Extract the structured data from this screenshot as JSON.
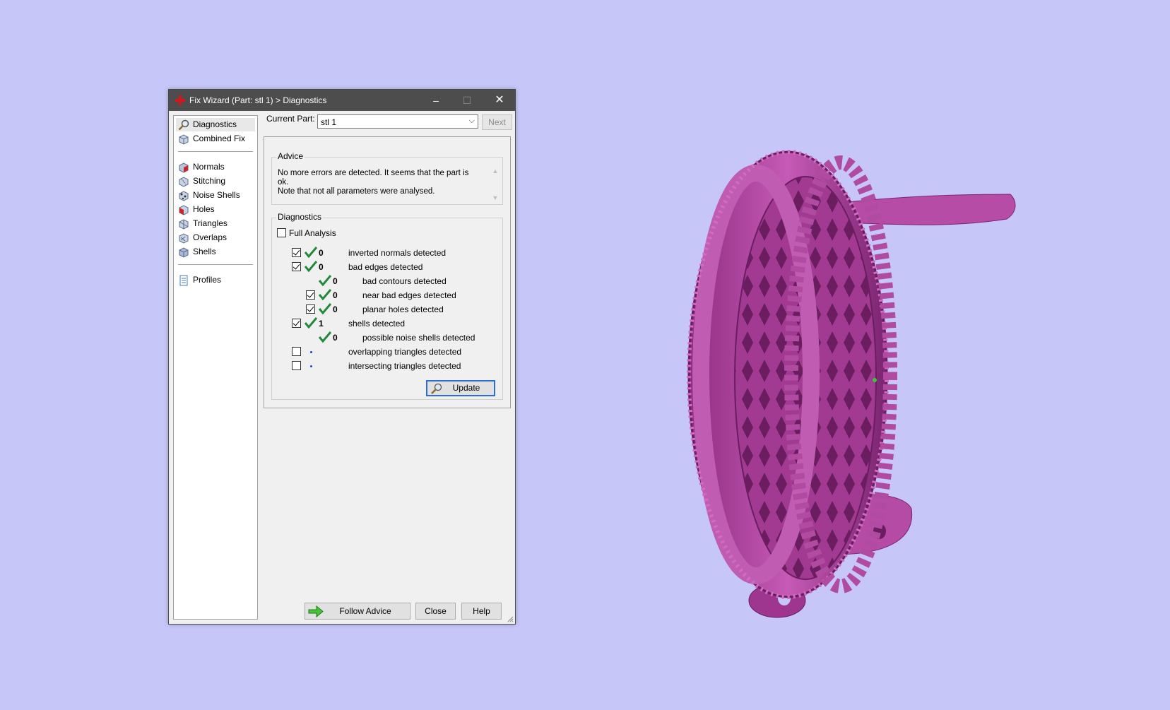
{
  "window": {
    "title": "Fix Wizard (Part: stl 1) > Diagnostics",
    "min_glyph": "–",
    "max_glyph": "☐",
    "close_glyph": "✕"
  },
  "sidebar": {
    "items": [
      {
        "label": "Diagnostics",
        "icon": "magnifier-icon"
      },
      {
        "label": "Combined Fix",
        "icon": "cube-icon"
      },
      {
        "label": "Normals",
        "icon": "cube-red-icon"
      },
      {
        "label": "Stitching",
        "icon": "cube-stitch-icon"
      },
      {
        "label": "Noise Shells",
        "icon": "noise-shells-icon"
      },
      {
        "label": "Holes",
        "icon": "cube-holes-icon"
      },
      {
        "label": "Triangles",
        "icon": "triangles-icon"
      },
      {
        "label": "Overlaps",
        "icon": "overlaps-icon"
      },
      {
        "label": "Shells",
        "icon": "shells-icon"
      },
      {
        "label": "Profiles",
        "icon": "document-icon"
      }
    ]
  },
  "header": {
    "current_part_label": "Current Part:",
    "current_part_value": "stl 1",
    "dropdown_arrow": "⌵",
    "next_label": "Next"
  },
  "advice": {
    "title": "Advice",
    "text": "No more errors are detected. It seems that the part is ok.\nNote that not all parameters were analysed.",
    "scroll_up": "▲",
    "scroll_down": "▼"
  },
  "diagnostics": {
    "title": "Diagnostics",
    "full_analysis_label": "Full Analysis",
    "rows": [
      {
        "checked": true,
        "value": "0",
        "label": "inverted normals detected"
      },
      {
        "checked": true,
        "value": "0",
        "label": "bad edges detected"
      },
      {
        "checked": null,
        "value": "0",
        "label": "bad contours detected"
      },
      {
        "checked": true,
        "value": "0",
        "label": "near bad edges detected"
      },
      {
        "checked": true,
        "value": "0",
        "label": "planar holes detected"
      },
      {
        "checked": true,
        "value": "1",
        "label": "shells detected"
      },
      {
        "checked": null,
        "value": "0",
        "label": "possible noise shells detected"
      },
      {
        "checked": false,
        "value": "",
        "label": "overlapping triangles detected"
      },
      {
        "checked": false,
        "value": "",
        "label": "intersecting triangles detected"
      }
    ],
    "update_label": "Update"
  },
  "footer": {
    "follow_advice_label": "Follow Advice",
    "close_label": "Close",
    "help_label": "Help"
  },
  "colors": {
    "background": "#c6c6f8",
    "model": "#b0419f",
    "tick": "#1f8a3a",
    "titlebar": "#4d4d4d"
  }
}
